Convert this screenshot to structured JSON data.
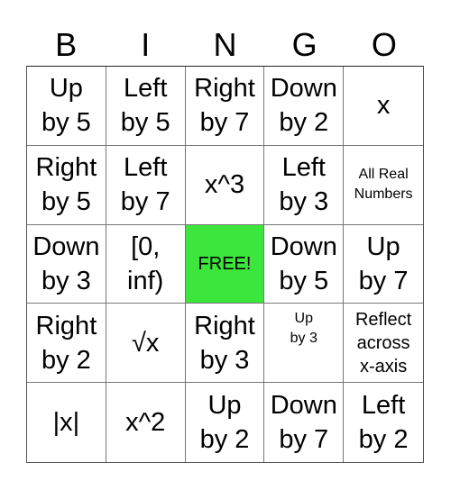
{
  "header": [
    "B",
    "I",
    "N",
    "G",
    "O"
  ],
  "free_color": "#3ce63c",
  "cells": [
    "Up\nby 5",
    "Left\nby 5",
    "Right\nby 7",
    "Down\nby 2",
    "x",
    "Right\nby 5",
    "Left\nby 7",
    "x^3",
    "Left\nby 3",
    "All Real\nNumbers",
    "Down\nby 3",
    "[0,\ninf)",
    "FREE!",
    "Down\nby 5",
    "Up\nby 7",
    "Right\nby 2",
    "√x",
    "Right\nby 3",
    "Up\nby 3",
    "Reflect\nacross\nx-axis",
    "|x|",
    "x^2",
    "Up\nby 2",
    "Down\nby 7",
    "Left\nby 2"
  ]
}
